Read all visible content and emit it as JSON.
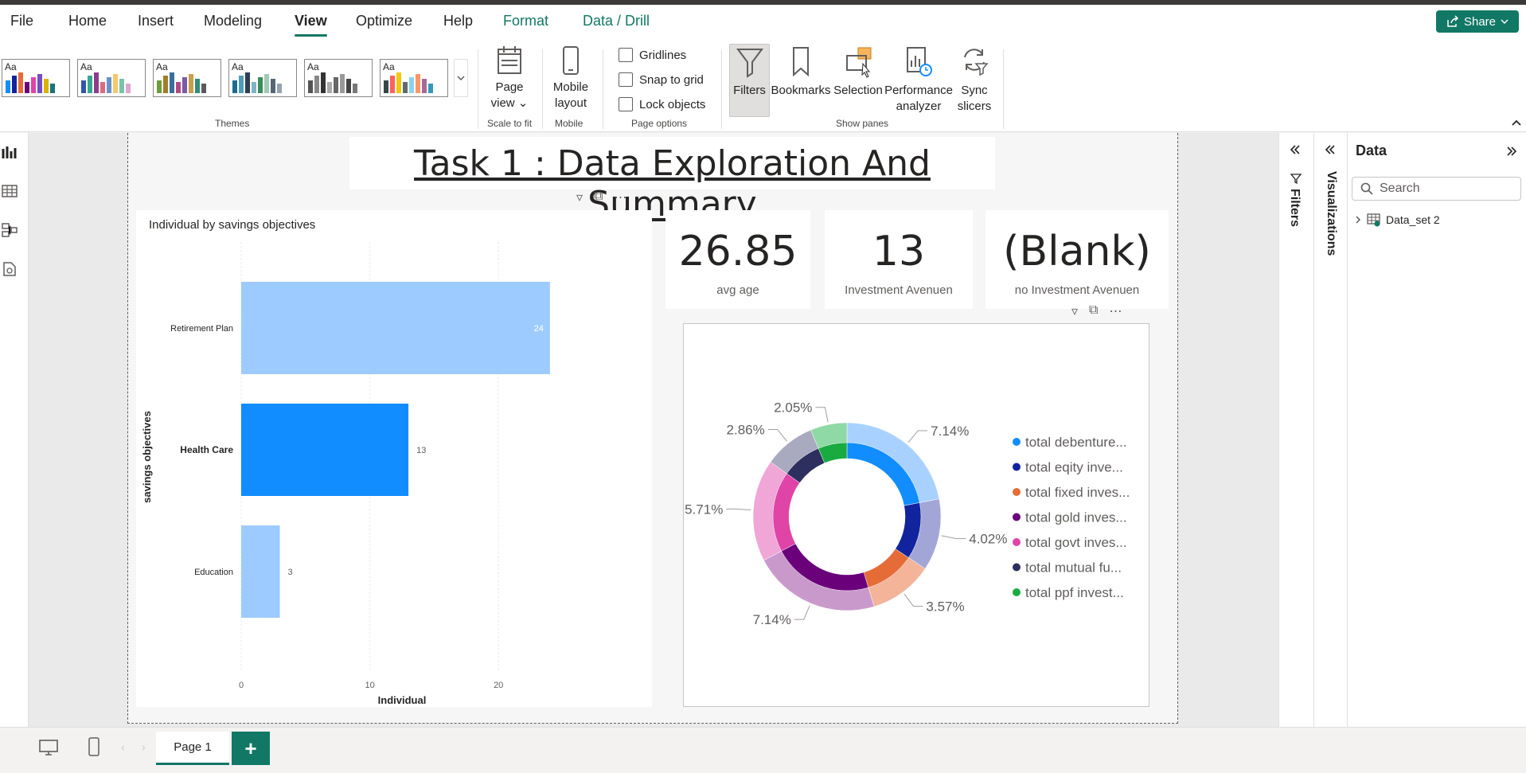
{
  "menu": {
    "file": "File",
    "home": "Home",
    "insert": "Insert",
    "modeling": "Modeling",
    "view": "View",
    "optimize": "Optimize",
    "help": "Help",
    "format": "Format",
    "data_drill": "Data / Drill"
  },
  "share": {
    "label": "Share"
  },
  "ribbon": {
    "themes_label": "Themes",
    "theme_sample_text": "Aa",
    "page_view": [
      "Page",
      "view"
    ],
    "scale_to_fit": "Scale to fit",
    "mobile_layout": [
      "Mobile",
      "layout"
    ],
    "mobile_group": "Mobile",
    "gridlines": "Gridlines",
    "snap_to_grid": "Snap to grid",
    "lock_objects": "Lock objects",
    "page_options": "Page options",
    "filters": "Filters",
    "bookmarks": "Bookmarks",
    "selection": "Selection",
    "performance": [
      "Performance",
      "analyzer"
    ],
    "sync_slicers": [
      "Sync",
      "slicers"
    ],
    "show_panes": "Show panes",
    "theme_palettes": [
      [
        "#118dff",
        "#12239e",
        "#e66c37",
        "#6b007b",
        "#e044a7",
        "#744ec2",
        "#d9b300",
        "#197278"
      ],
      [
        "#3257a8",
        "#37a794",
        "#8b3d88",
        "#dd6b7f",
        "#6b91c9",
        "#f5c869",
        "#77c4a8",
        "#dea6cf"
      ],
      [
        "#6d9c3a",
        "#a17e2a",
        "#3a6f9c",
        "#b34a84",
        "#7a5aa5",
        "#c6a04a",
        "#2e8f76",
        "#5a5a5a"
      ],
      [
        "#1d6b8f",
        "#4f9bb8",
        "#2d3e50",
        "#7fb3c6",
        "#3c8b5a",
        "#a1c9b4",
        "#556677",
        "#94a3b0"
      ],
      [
        "#555555",
        "#888888",
        "#333333",
        "#aaaaaa",
        "#666666",
        "#999999",
        "#444444",
        "#777777"
      ],
      [
        "#374649",
        "#fd625e",
        "#f2c80f",
        "#5f6b6d",
        "#8ad4eb",
        "#fe9666",
        "#a66999",
        "#3599b8"
      ]
    ]
  },
  "report": {
    "title": "Task 1 : Data Exploration And Summary",
    "cards": [
      {
        "value": "26.85",
        "label": "avg age"
      },
      {
        "value": "13",
        "label": "Investment Avenuen"
      },
      {
        "value": "(Blank)",
        "label": "no Investment Avenuen"
      }
    ]
  },
  "chart_data": [
    {
      "type": "bar",
      "orientation": "horizontal",
      "title": "Individual by savings objectives",
      "xlabel": "Individual",
      "ylabel": "savings objectives",
      "categories": [
        "Retirement Plan",
        "Health Care",
        "Education"
      ],
      "values": [
        24,
        13,
        3
      ],
      "data_labels": [
        "24",
        "13",
        "3"
      ],
      "highlighted_category": "Health Care",
      "xlim": [
        0,
        25
      ],
      "x_ticks": [
        0,
        10,
        20
      ],
      "colors": {
        "bar": "#9ecbff",
        "highlight": "#118dff"
      }
    },
    {
      "type": "pie",
      "variant": "donut",
      "legend_position": "right",
      "legend": [
        {
          "label": "total debenture...",
          "color": "#118dff"
        },
        {
          "label": "total eqity inve...",
          "color": "#12239e"
        },
        {
          "label": "total fixed inves...",
          "color": "#e66c37"
        },
        {
          "label": "total gold inves...",
          "color": "#6b007b"
        },
        {
          "label": "total govt inves...",
          "color": "#e044a7"
        },
        {
          "label": "total mutual fu...",
          "color": "#2d2f5e"
        },
        {
          "label": "total ppf invest...",
          "color": "#1aab40"
        }
      ],
      "outer_slices": [
        {
          "percent": 7.14,
          "label": "7.14%",
          "color": "#a9d1ff"
        },
        {
          "percent": 4.02,
          "label": "4.02%",
          "color": "#a2a6d6"
        },
        {
          "percent": 3.57,
          "label": "3.57%",
          "color": "#f4b49a"
        },
        {
          "percent": 7.14,
          "label": "7.14%",
          "color": "#c999cc"
        },
        {
          "percent": 5.71,
          "label": "5.71%",
          "color": "#f0a6d6"
        },
        {
          "percent": 2.86,
          "label": "2.86%",
          "color": "#a9a9bf"
        },
        {
          "percent": 2.05,
          "label": "2.05%",
          "color": "#8fd9a4"
        }
      ],
      "inner_slices": [
        {
          "percent": 7.14,
          "color": "#118dff"
        },
        {
          "percent": 4.02,
          "color": "#12239e"
        },
        {
          "percent": 3.57,
          "color": "#e66c37"
        },
        {
          "percent": 7.14,
          "color": "#6b007b"
        },
        {
          "percent": 5.71,
          "color": "#e044a7"
        },
        {
          "percent": 2.86,
          "color": "#2d2f5e"
        },
        {
          "percent": 2.05,
          "color": "#1aab40"
        }
      ]
    }
  ],
  "panes": {
    "filters": "Filters",
    "visualizations": "Visualizations",
    "data": "Data",
    "search_placeholder": "Search",
    "dataset": "Data_set 2"
  },
  "bottom": {
    "page_tab": "Page 1",
    "add_page": "+"
  }
}
